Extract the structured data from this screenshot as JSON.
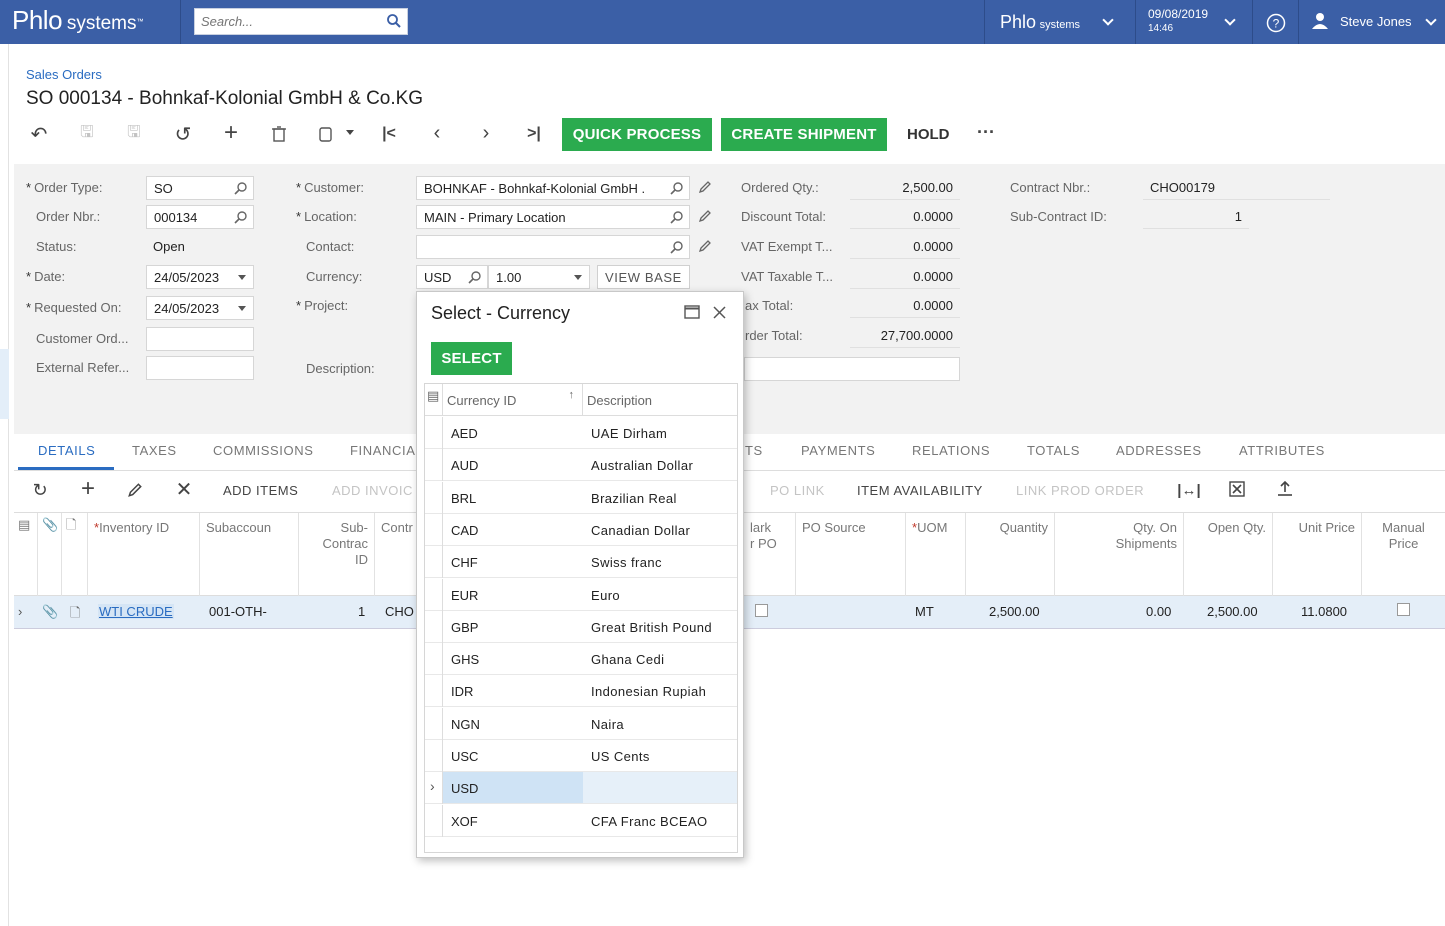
{
  "topbar": {
    "logo_main": "Phlo",
    "logo_sub": "systems",
    "logo_tm": "™",
    "search_placeholder": "Search...",
    "company_main": "Phlo",
    "company_sub": "systems",
    "date": "09/08/2019",
    "time": "14:46",
    "user": "Steve Jones"
  },
  "breadcrumb": "Sales Orders",
  "title": "SO 000134 - Bohnkaf-Kolonial GmbH & Co.KG",
  "toolbar": {
    "quick_process": "QUICK PROCESS",
    "create_shipment": "CREATE SHIPMENT",
    "hold": "HOLD",
    "more": "···"
  },
  "form": {
    "order_type_label": "Order Type:",
    "order_type": "SO",
    "order_nbr_label": "Order Nbr.:",
    "order_nbr": "000134",
    "status_label": "Status:",
    "status": "Open",
    "date_label": "Date:",
    "date": "24/05/2023",
    "requested_on_label": "Requested On:",
    "requested_on": "24/05/2023",
    "customer_ord_label": "Customer Ord...",
    "external_refer_label": "External Refer...",
    "customer_label": "Customer:",
    "customer": "BOHNKAF - Bohnkaf-Kolonial GmbH .",
    "location_label": "Location:",
    "location": "MAIN - Primary Location",
    "contact_label": "Contact:",
    "currency_label": "Currency:",
    "currency": "USD",
    "rate": "1.00",
    "view_base": "VIEW BASE",
    "project_label": "Project:",
    "description_label": "Description:",
    "ordered_qty_label": "Ordered Qty.:",
    "ordered_qty": "2,500.00",
    "discount_total_label": "Discount Total:",
    "discount_total": "0.0000",
    "vat_exempt_label": "VAT Exempt T...",
    "vat_exempt": "0.0000",
    "vat_taxable_label": "VAT Taxable T...",
    "vat_taxable": "0.0000",
    "tax_total_label": "ax Total:",
    "tax_total": "0.0000",
    "order_total_label": "rder Total:",
    "order_total": "27,700.0000",
    "contract_nbr_label": "Contract Nbr.:",
    "contract_nbr": "CHO00179",
    "sub_contract_label": "Sub-Contract ID:",
    "sub_contract": "1"
  },
  "tabs": {
    "details": "DETAILS",
    "taxes": "TAXES",
    "commissions": "COMMISSIONS",
    "financial": "FINANCIA",
    "shipments_partial": "TS",
    "payments": "PAYMENTS",
    "relations": "RELATIONS",
    "totals": "TOTALS",
    "addresses": "ADDRESSES",
    "attributes": "ATTRIBUTES"
  },
  "grid_toolbar": {
    "add_items": "ADD ITEMS",
    "add_invoice": "ADD INVOIC",
    "po_link": "PO LINK",
    "item_availability": "ITEM AVAILABILITY",
    "link_prod_order": "LINK PROD ORDER"
  },
  "grid": {
    "headers": {
      "inventory_id": "Inventory ID",
      "subaccount": "Subaccoun",
      "sub_contract_1": "Sub-",
      "sub_contract_2": "Contrac",
      "sub_contract_3": "ID",
      "contract": "Contr",
      "mark_po_1": "lark",
      "mark_po_2": "r PO",
      "po_source": "PO Source",
      "uom": "UOM",
      "quantity": "Quantity",
      "qty_on_ship_1": "Qty. On",
      "qty_on_ship_2": "Shipments",
      "open_qty": "Open Qty.",
      "unit_price": "Unit Price",
      "manual_price_1": "Manual",
      "manual_price_2": "Price"
    },
    "row": {
      "inventory_id": "WTI CRUDE",
      "subaccount": "001-OTH-",
      "sub_contract_id": "1",
      "contract": "CHO",
      "uom": "MT",
      "quantity": "2,500.00",
      "qty_on_shipments": "0.00",
      "open_qty": "2,500.00",
      "unit_price": "11.0800"
    }
  },
  "dialog": {
    "title": "Select - Currency",
    "select_button": "SELECT",
    "col_currency_id": "Currency ID",
    "col_description": "Description",
    "rows": [
      {
        "id": "AED",
        "desc": "UAE Dirham"
      },
      {
        "id": "AUD",
        "desc": "Australian Dollar"
      },
      {
        "id": "BRL",
        "desc": "Brazilian Real"
      },
      {
        "id": "CAD",
        "desc": "Canadian Dollar"
      },
      {
        "id": "CHF",
        "desc": "Swiss franc"
      },
      {
        "id": "EUR",
        "desc": "Euro"
      },
      {
        "id": "GBP",
        "desc": "Great British Pound"
      },
      {
        "id": "GHS",
        "desc": "Ghana Cedi"
      },
      {
        "id": "IDR",
        "desc": "Indonesian Rupiah"
      },
      {
        "id": "NGN",
        "desc": "Naira"
      },
      {
        "id": "USC",
        "desc": "US Cents"
      },
      {
        "id": "USD",
        "desc": ""
      },
      {
        "id": "XOF",
        "desc": "CFA Franc BCEAO"
      }
    ],
    "selected_id": "USD"
  },
  "colors": {
    "topbar": "#3b5fa6",
    "accent_green": "#2bab4f",
    "link_blue": "#2a6cc1",
    "selected_row": "#cfe3f5"
  }
}
